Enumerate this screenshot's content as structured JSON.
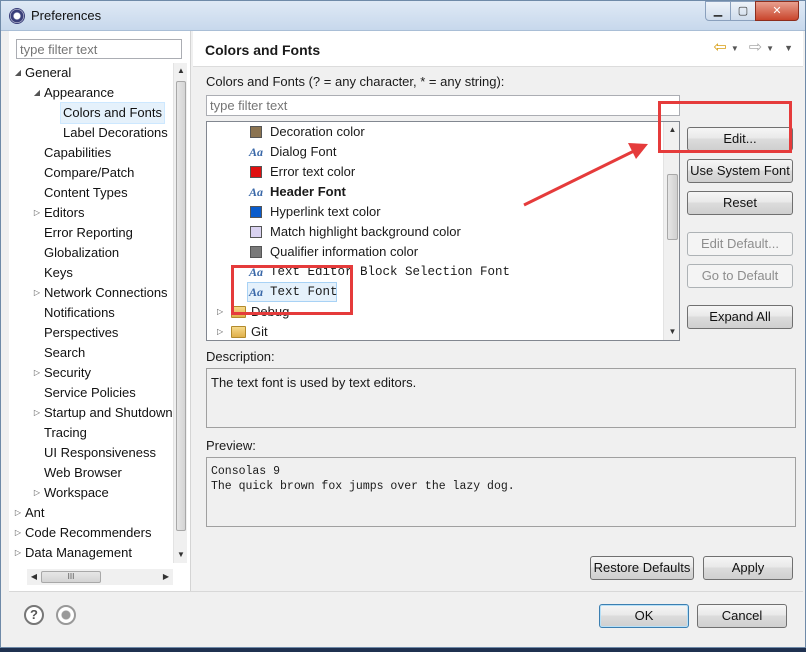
{
  "window": {
    "title": "Preferences",
    "min_label": "▁",
    "max_label": "▢",
    "close_label": "✕"
  },
  "left": {
    "filter_placeholder": "type filter text",
    "tree": [
      {
        "label": "General",
        "indent": 0,
        "twisty": "◢"
      },
      {
        "label": "Appearance",
        "indent": 1,
        "twisty": "◢"
      },
      {
        "label": "Colors and Fonts",
        "indent": 2,
        "twisty": "",
        "selected": true
      },
      {
        "label": "Label Decorations",
        "indent": 2,
        "twisty": ""
      },
      {
        "label": "Capabilities",
        "indent": 1,
        "twisty": ""
      },
      {
        "label": "Compare/Patch",
        "indent": 1,
        "twisty": ""
      },
      {
        "label": "Content Types",
        "indent": 1,
        "twisty": ""
      },
      {
        "label": "Editors",
        "indent": 1,
        "twisty": "▷"
      },
      {
        "label": "Error Reporting",
        "indent": 1,
        "twisty": ""
      },
      {
        "label": "Globalization",
        "indent": 1,
        "twisty": ""
      },
      {
        "label": "Keys",
        "indent": 1,
        "twisty": ""
      },
      {
        "label": "Network Connections",
        "indent": 1,
        "twisty": "▷"
      },
      {
        "label": "Notifications",
        "indent": 1,
        "twisty": ""
      },
      {
        "label": "Perspectives",
        "indent": 1,
        "twisty": ""
      },
      {
        "label": "Search",
        "indent": 1,
        "twisty": ""
      },
      {
        "label": "Security",
        "indent": 1,
        "twisty": "▷"
      },
      {
        "label": "Service Policies",
        "indent": 1,
        "twisty": ""
      },
      {
        "label": "Startup and Shutdown",
        "indent": 1,
        "twisty": "▷"
      },
      {
        "label": "Tracing",
        "indent": 1,
        "twisty": ""
      },
      {
        "label": "UI Responsiveness",
        "indent": 1,
        "twisty": ""
      },
      {
        "label": "Web Browser",
        "indent": 1,
        "twisty": ""
      },
      {
        "label": "Workspace",
        "indent": 1,
        "twisty": "▷"
      },
      {
        "label": "Ant",
        "indent": 0,
        "twisty": "▷"
      },
      {
        "label": "Code Recommenders",
        "indent": 0,
        "twisty": "▷"
      },
      {
        "label": "Data Management",
        "indent": 0,
        "twisty": "▷"
      }
    ],
    "hscroll_grip": "III"
  },
  "page": {
    "title": "Colors and Fonts",
    "back_icon": "⇦",
    "forward_icon": "⇨",
    "dropdown": "▼",
    "menu": "▼",
    "filter_label": "Colors and Fonts (? = any character, * = any string):",
    "filter_placeholder": "type filter text",
    "items": [
      {
        "label": "Decoration color",
        "kind": "color",
        "color": "#8b7350"
      },
      {
        "label": "Dialog Font",
        "kind": "font",
        "bold": false
      },
      {
        "label": "Error text color",
        "kind": "color",
        "color": "#e01010"
      },
      {
        "label": "Header Font",
        "kind": "font",
        "bold": true
      },
      {
        "label": "Hyperlink text color",
        "kind": "color",
        "color": "#0a5ccc"
      },
      {
        "label": "Match highlight background color",
        "kind": "color",
        "color": "#d9d2f0"
      },
      {
        "label": "Qualifier information color",
        "kind": "color",
        "color": "#7a7a7a"
      },
      {
        "label": "Text Editor Block Selection Font",
        "kind": "font",
        "mono": true
      },
      {
        "label": "Text Font",
        "kind": "font",
        "mono": true,
        "selected": true
      }
    ],
    "groups": [
      {
        "label": "Debug"
      },
      {
        "label": "Git"
      }
    ],
    "font_icon_text": "Aa",
    "buttons": {
      "edit": "Edit...",
      "use_system_font": "Use System Font",
      "reset": "Reset",
      "edit_default": "Edit Default...",
      "go_to_default": "Go to Default",
      "expand_all": "Expand All"
    },
    "description_label": "Description:",
    "description_text": "The text font is used by text editors.",
    "preview_label": "Preview:",
    "preview_lines": [
      "Consolas 9",
      "The quick brown fox jumps over the lazy dog."
    ],
    "restore_defaults": "Restore Defaults",
    "apply": "Apply"
  },
  "footer": {
    "help_icon_text": "?",
    "ok": "OK",
    "cancel": "Cancel"
  },
  "colors": {
    "annotation_red": "#e53b3b",
    "selection_bg": "#e5f1fb"
  }
}
